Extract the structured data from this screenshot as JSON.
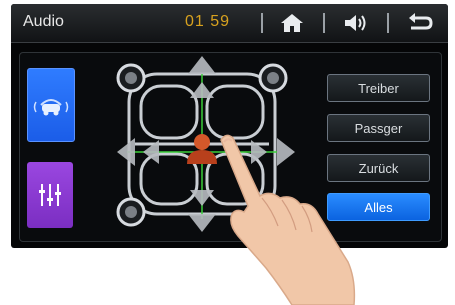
{
  "header": {
    "title": "Audio",
    "clock": "01 59",
    "icons": [
      "home-icon",
      "volume-icon",
      "back-icon"
    ]
  },
  "sidebar": {
    "items": [
      {
        "icon": "car-balance-icon",
        "active": true
      },
      {
        "icon": "equalizer-icon",
        "active": false
      }
    ]
  },
  "buttons": {
    "treiber": "Treiber",
    "passger": "Passger",
    "zuruck": "Zurück",
    "alles": "Alles"
  },
  "colors": {
    "accent_blue": "#1b6cf2",
    "accent_purple": "#8a3ad6",
    "clock_orange": "#d8a21f"
  }
}
